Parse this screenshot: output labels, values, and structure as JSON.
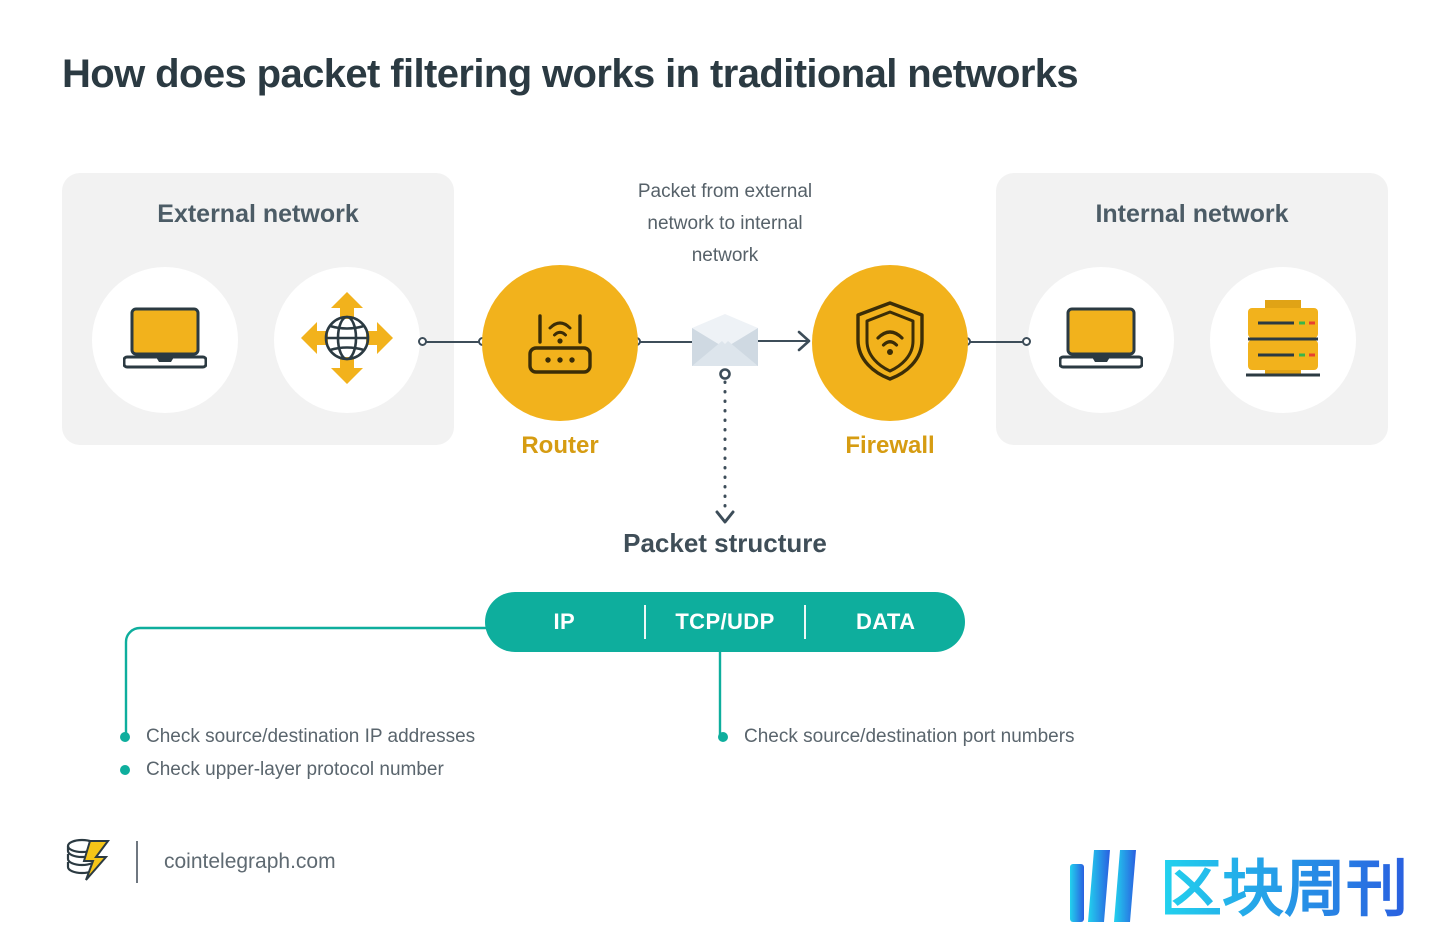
{
  "title": "How does packet filtering works in traditional networks",
  "colors": {
    "title": "#2b3a42",
    "panel_bg": "#f2f2f2",
    "node_yellow": "#f2b21c",
    "node_label": "#d69c12",
    "teal": "#0eae9d",
    "line_dark": "#3d4d59",
    "body_text": "#5a656d"
  },
  "panels": [
    {
      "id": "external",
      "title": "External network",
      "icons": [
        {
          "name": "laptop-icon",
          "label": "laptop"
        },
        {
          "name": "globe-arrows-icon",
          "label": "globe with directional arrows"
        }
      ]
    },
    {
      "id": "internal",
      "title": "Internal network",
      "icons": [
        {
          "name": "laptop-icon",
          "label": "laptop"
        },
        {
          "name": "server-icon",
          "label": "server rack"
        }
      ]
    }
  ],
  "nodes": [
    {
      "id": "router",
      "label": "Router",
      "icon": "router-icon"
    },
    {
      "id": "firewall",
      "label": "Firewall",
      "icon": "shield-wifi-icon"
    }
  ],
  "packet": {
    "caption_lines": [
      "Packet from external",
      "network to internal",
      "network"
    ],
    "icon": "envelope-icon"
  },
  "packet_structure": {
    "title": "Packet structure",
    "fields": [
      "IP",
      "TCP/UDP",
      "DATA"
    ]
  },
  "annotations": {
    "left": [
      "Check source/destination IP addresses",
      "Check upper-layer protocol number"
    ],
    "right": [
      "Check source/destination port numbers"
    ]
  },
  "footer": {
    "logo": "cointelegraph-logo",
    "site": "cointelegraph.com"
  },
  "watermark": {
    "name": "qukuai-zhoukan-logo",
    "text": "区块周刊"
  }
}
